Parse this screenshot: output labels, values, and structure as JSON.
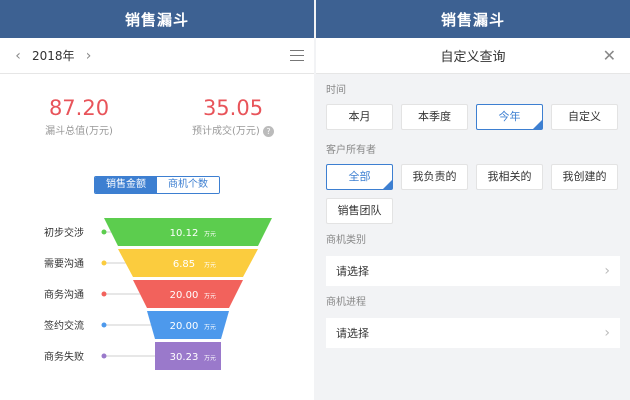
{
  "left": {
    "title": "销售漏斗",
    "year": "2018年",
    "icons": {
      "prev": "chevron-left-icon",
      "next": "chevron-right-icon",
      "list": "list-icon"
    },
    "kpi_total": {
      "value": "87.20",
      "label": "漏斗总值(万元)"
    },
    "kpi_expected": {
      "value": "35.05",
      "label": "预计成交(万元)",
      "help": "?"
    },
    "tabs": {
      "amount": "销售金额",
      "count": "商机个数"
    },
    "funnel": {
      "unit": "万元",
      "stages": [
        {
          "label": "初步交涉",
          "value": "10.12",
          "color": "#5ccd4e"
        },
        {
          "label": "需要沟通",
          "value": "6.85",
          "color": "#fbcc3e"
        },
        {
          "label": "商务沟通",
          "value": "20.00",
          "color": "#f2625c"
        },
        {
          "label": "签约交流",
          "value": "20.00",
          "color": "#4d99ec"
        },
        {
          "label": "商务失败",
          "value": "30.23",
          "color": "#9a79cb"
        }
      ]
    }
  },
  "right": {
    "title": "销售漏斗",
    "dialog_title": "自定义查询",
    "close_icon": "close-icon",
    "time": {
      "label": "时间",
      "options": [
        "本月",
        "本季度",
        "今年",
        "自定义"
      ],
      "selected": "今年"
    },
    "owner": {
      "label": "客户所有者",
      "options": [
        "全部",
        "我负责的",
        "我相关的",
        "我创建的",
        "销售团队"
      ],
      "selected": "全部"
    },
    "category": {
      "label": "商机类别",
      "value": "请选择"
    },
    "progress": {
      "label": "商机进程",
      "value": "请选择"
    }
  }
}
